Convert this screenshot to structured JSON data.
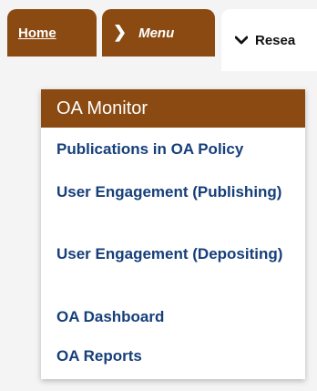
{
  "tabs": {
    "home_label": "Home",
    "menu_label": "Menu",
    "menu_chevron": "❯",
    "research_label": "Resea",
    "research_chevron": "❯"
  },
  "menu": {
    "header": "OA Monitor",
    "items": [
      {
        "label": "Publications in OA Policy"
      },
      {
        "label": "User Engagement (Publishing)"
      },
      {
        "label": "User Engagement (Depositing)"
      },
      {
        "label": "OA Dashboard"
      },
      {
        "label": "OA Reports"
      }
    ]
  },
  "colors": {
    "brand_brown": "#8a4a12",
    "link_blue": "#163f7a",
    "background": "#f4f4f4"
  }
}
